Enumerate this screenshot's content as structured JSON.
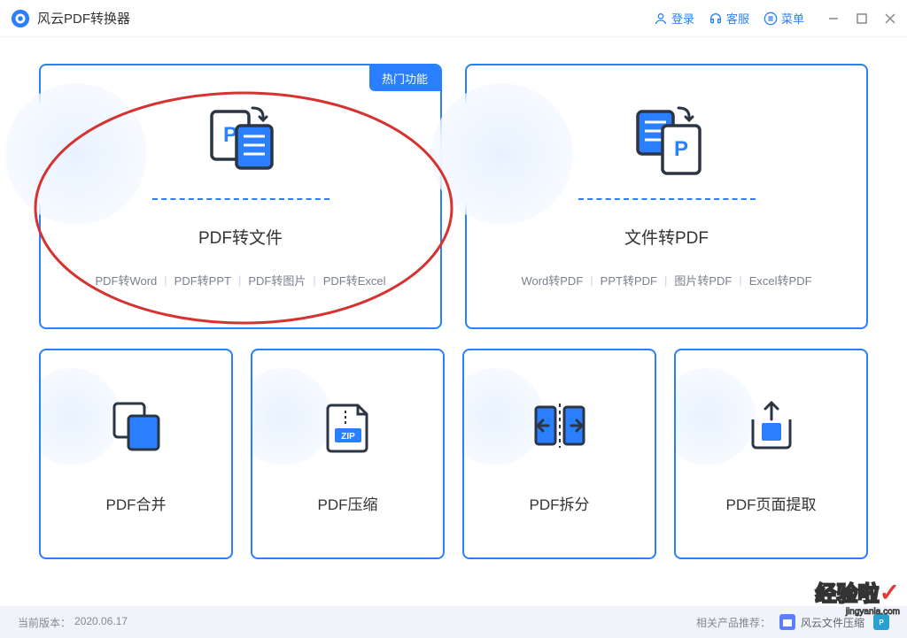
{
  "titlebar": {
    "app_title": "风云PDF转换器",
    "login": "登录",
    "support": "客服",
    "menu": "菜单"
  },
  "cards": {
    "large": [
      {
        "title": "PDF转文件",
        "hot_badge": "热门功能",
        "subs": [
          "PDF转Word",
          "PDF转PPT",
          "PDF转图片",
          "PDF转Excel"
        ]
      },
      {
        "title": "文件转PDF",
        "subs": [
          "Word转PDF",
          "PPT转PDF",
          "图片转PDF",
          "Excel转PDF"
        ]
      }
    ],
    "small": [
      {
        "title": "PDF合并"
      },
      {
        "title": "PDF压缩"
      },
      {
        "title": "PDF拆分"
      },
      {
        "title": "PDF页面提取"
      }
    ]
  },
  "footer": {
    "version_label": "当前版本：",
    "version": "2020.06.17",
    "recommend_label": "相关产品推荐：",
    "products": [
      "风云文件压缩"
    ]
  },
  "watermark": {
    "main": "经验啦",
    "sub": "jingyanla.com"
  }
}
